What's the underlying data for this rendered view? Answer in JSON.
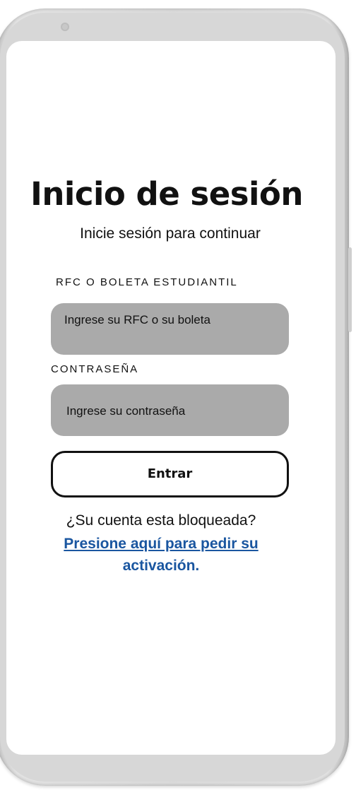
{
  "login": {
    "title": "Inicio de sesión",
    "subtitle": "Inicie sesión para continuar",
    "rfc_label": "RFC O BOLETA ESTUDIANTIL",
    "rfc_placeholder": "Ingrese su RFC o su boleta",
    "password_label": "CONTRASEÑA",
    "password_placeholder": "Ingrese su contraseña",
    "submit_label": "Entrar",
    "locked_question": "¿Su cuenta esta bloqueada?",
    "activation_link_line1": "Presione aquí para pedir su",
    "activation_link_line2": "activación."
  },
  "colors": {
    "input_background": "#aaaaaa",
    "link": "#1a56a0",
    "text": "#111111",
    "screen_background": "#ffffff"
  }
}
